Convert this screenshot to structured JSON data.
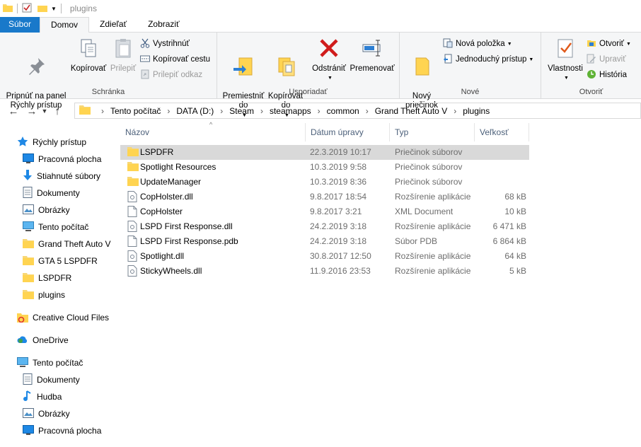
{
  "window": {
    "title": "plugins"
  },
  "tabs": [
    {
      "label": "Súbor"
    },
    {
      "label": "Domov"
    },
    {
      "label": "Zdieľať"
    },
    {
      "label": "Zobraziť"
    }
  ],
  "ribbon": {
    "clipboard": {
      "group_label": "Schránka",
      "pin": "Pripnúť na panel\nRýchly prístup",
      "copy": "Kopírovať",
      "paste": "Prilepiť",
      "cut": "Vystrihnúť",
      "copy_path": "Kopírovať cestu",
      "paste_shortcut": "Prilepiť odkaz"
    },
    "organize": {
      "group_label": "Usporiadať",
      "move_to": "Premiestniť\ndo",
      "copy_to": "Kopírovať\ndo",
      "delete": "Odstrániť",
      "rename": "Premenovať"
    },
    "new": {
      "group_label": "Nové",
      "new_folder": "Nový\npriečinok",
      "new_item": "Nová položka",
      "easy_access": "Jednoduchý prístup"
    },
    "open": {
      "group_label": "Otvoriť",
      "properties": "Vlastnosti",
      "open": "Otvoriť",
      "edit": "Upraviť",
      "history": "História"
    }
  },
  "address": {
    "crumbs": [
      "Tento počítač",
      "DATA (D:)",
      "Steam",
      "steamapps",
      "common",
      "Grand Theft Auto V",
      "plugins"
    ]
  },
  "sidebar": {
    "quick_access": "Rýchly prístup",
    "items": [
      {
        "label": "Pracovná plocha",
        "icon": "desktop-icon"
      },
      {
        "label": "Stiahnuté súbory",
        "icon": "download-icon"
      },
      {
        "label": "Dokumenty",
        "icon": "documents-icon"
      },
      {
        "label": "Obrázky",
        "icon": "pictures-icon"
      },
      {
        "label": "Tento počítač",
        "icon": "computer-icon"
      },
      {
        "label": "Grand Theft Auto V",
        "icon": "folder-icon"
      },
      {
        "label": "GTA 5 LSPDFR",
        "icon": "folder-icon"
      },
      {
        "label": "LSPDFR",
        "icon": "folder-icon"
      },
      {
        "label": "plugins",
        "icon": "folder-icon"
      }
    ],
    "creative_cloud": "Creative Cloud Files",
    "onedrive": "OneDrive",
    "this_pc": "Tento počítač",
    "pc_items": [
      {
        "label": "Dokumenty",
        "icon": "documents-icon"
      },
      {
        "label": "Hudba",
        "icon": "music-icon"
      },
      {
        "label": "Obrázky",
        "icon": "pictures-icon"
      },
      {
        "label": "Pracovná plocha",
        "icon": "desktop-icon"
      }
    ]
  },
  "columns": {
    "name": "Názov",
    "date": "Dátum úpravy",
    "type": "Typ",
    "size": "Veľkosť"
  },
  "files": [
    {
      "name": "LSPDFR",
      "date": "22.3.2019 10:17",
      "type": "Priečinok súborov",
      "size": "",
      "kind": "folder"
    },
    {
      "name": "Spotlight Resources",
      "date": "10.3.2019 9:58",
      "type": "Priečinok súborov",
      "size": "",
      "kind": "folder"
    },
    {
      "name": "UpdateManager",
      "date": "10.3.2019 8:36",
      "type": "Priečinok súborov",
      "size": "",
      "kind": "folder"
    },
    {
      "name": "CopHolster.dll",
      "date": "9.8.2017 18:54",
      "type": "Rozšírenie aplikácie",
      "size": "68 kB",
      "kind": "dll"
    },
    {
      "name": "CopHolster",
      "date": "9.8.2017 3:21",
      "type": "XML Document",
      "size": "10 kB",
      "kind": "file"
    },
    {
      "name": "LSPD First Response.dll",
      "date": "24.2.2019 3:18",
      "type": "Rozšírenie aplikácie",
      "size": "6 471 kB",
      "kind": "dll"
    },
    {
      "name": "LSPD First Response.pdb",
      "date": "24.2.2019 3:18",
      "type": "Súbor PDB",
      "size": "6 864 kB",
      "kind": "file"
    },
    {
      "name": "Spotlight.dll",
      "date": "30.8.2017 12:50",
      "type": "Rozšírenie aplikácie",
      "size": "64 kB",
      "kind": "dll"
    },
    {
      "name": "StickyWheels.dll",
      "date": "11.9.2016 23:53",
      "type": "Rozšírenie aplikácie",
      "size": "5 kB",
      "kind": "dll"
    }
  ]
}
